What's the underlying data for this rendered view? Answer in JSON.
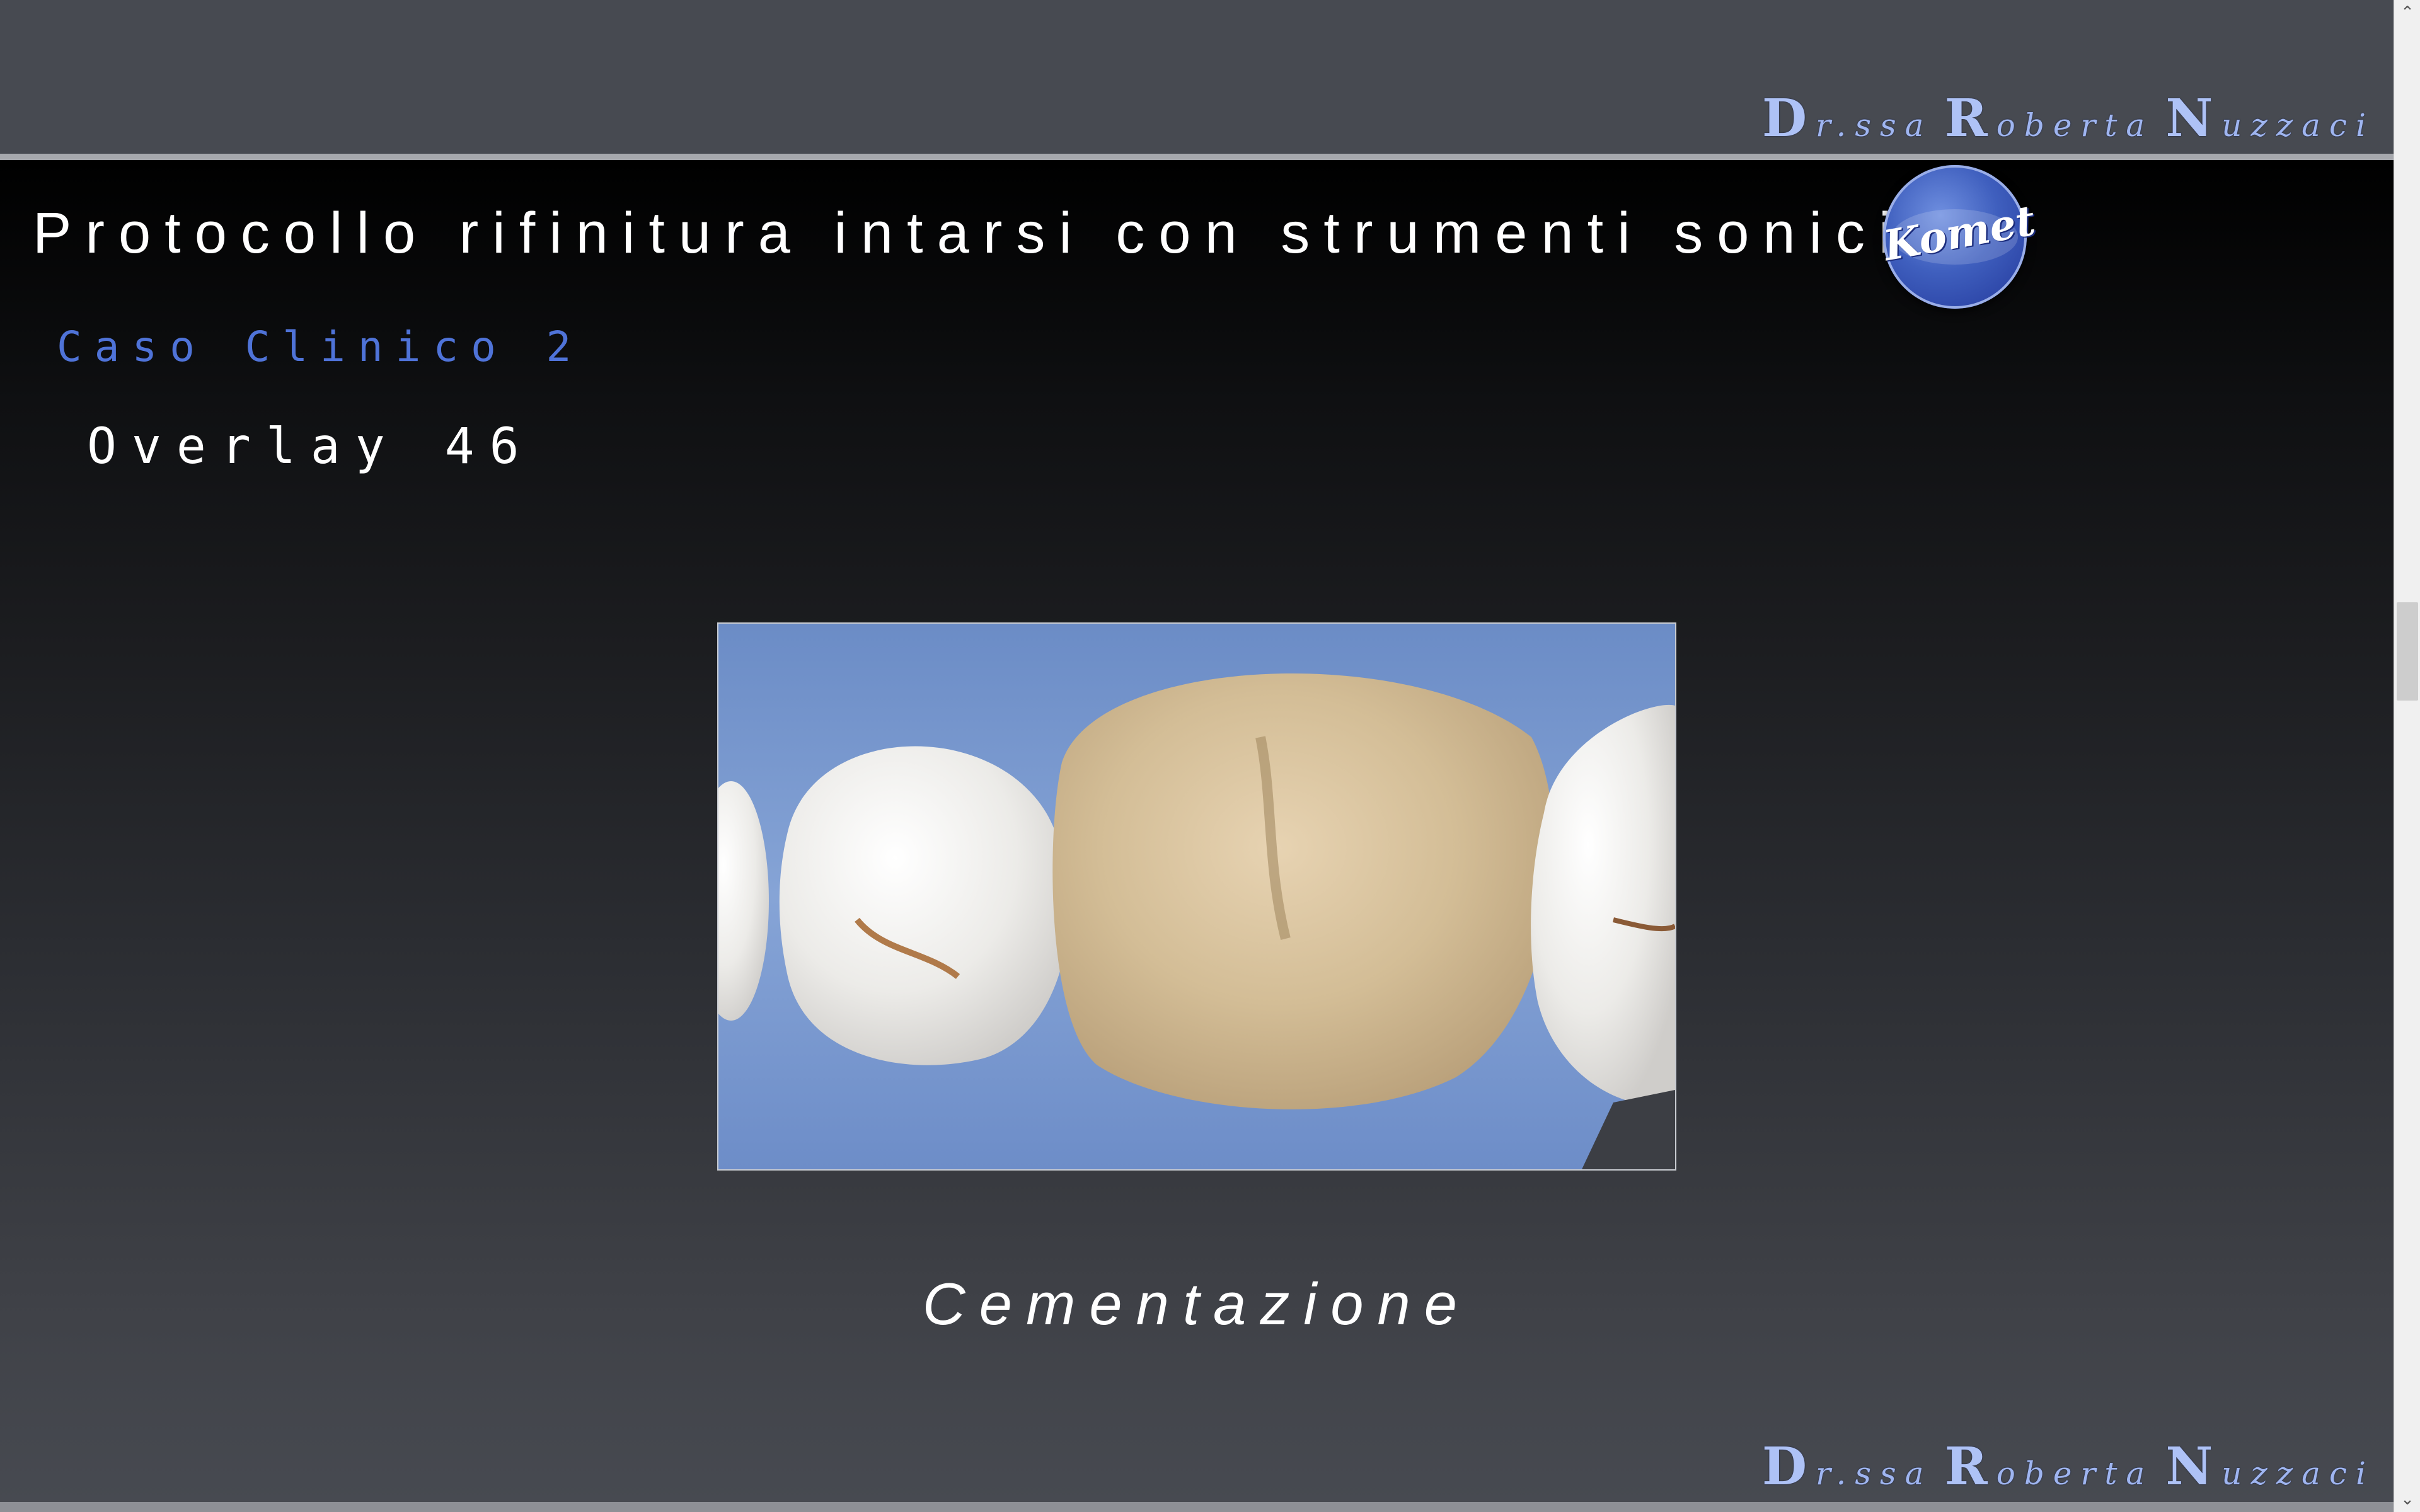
{
  "header": {
    "signature": {
      "d": "D",
      "d_rest": "r.ssa",
      "r": "R",
      "r_rest": "oberta",
      "n": "N",
      "n_rest": "uzzaci"
    }
  },
  "slide": {
    "title": "Protocollo rifinitura intarsi con strumenti sonici",
    "logo_text": "Komet",
    "subtitle": "Caso Clinico 2",
    "case_label": "Overlay 46",
    "caption": "Cementazione"
  },
  "footer": {
    "signature": {
      "d": "D",
      "d_rest": "r.ssa",
      "r": "R",
      "r_rest": "oberta",
      "n": "N",
      "n_rest": "uzzaci"
    }
  },
  "scrollbar": {
    "up_icon": "chevron-up-icon",
    "down_icon": "chevron-down-icon"
  },
  "colors": {
    "accent": "#4f73d8",
    "signature": "#9fb5f0",
    "background": "#474a51"
  }
}
